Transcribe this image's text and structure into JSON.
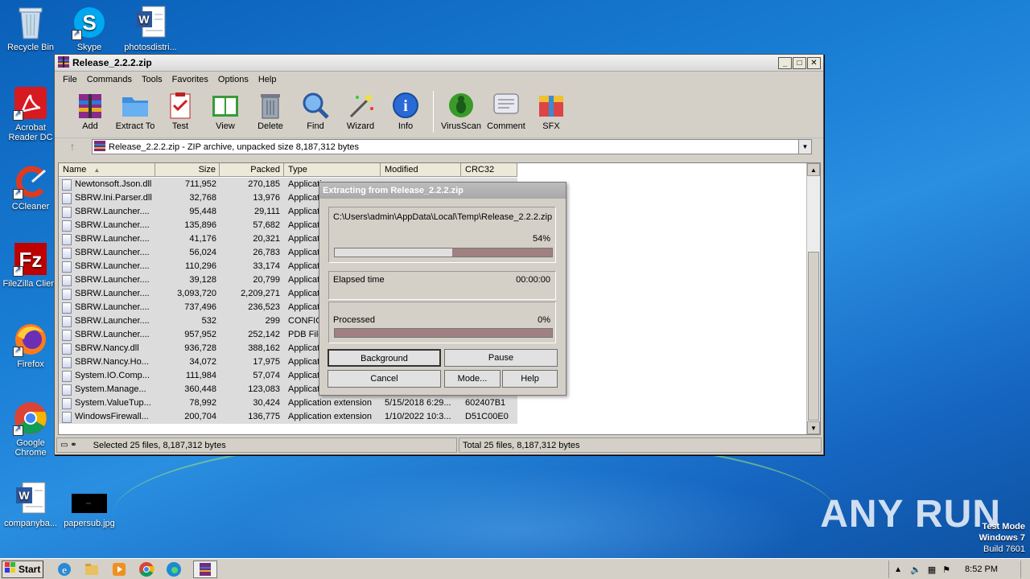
{
  "desktop": {
    "icons": [
      {
        "label": "Recycle Bin",
        "icon": "recycle-bin-icon"
      },
      {
        "label": "Skype",
        "icon": "skype-icon"
      },
      {
        "label": "photosdistri...",
        "icon": "word-document-icon"
      },
      {
        "label": "Acrobat Reader DC",
        "icon": "acrobat-icon"
      },
      {
        "label": "CCleaner",
        "icon": "ccleaner-icon"
      },
      {
        "label": "FileZilla Client",
        "icon": "filezilla-icon"
      },
      {
        "label": "Firefox",
        "icon": "firefox-icon"
      },
      {
        "label": "Google Chrome",
        "icon": "chrome-icon"
      },
      {
        "label": "companyba...",
        "icon": "word-document-icon"
      },
      {
        "label": "papersub.jpg",
        "icon": "image-file-icon"
      }
    ]
  },
  "window": {
    "title": "Release_2.2.2.zip",
    "menu": [
      "File",
      "Commands",
      "Tools",
      "Favorites",
      "Options",
      "Help"
    ],
    "toolbar": [
      {
        "label": "Add",
        "icon": "add-archive-icon"
      },
      {
        "label": "Extract To",
        "icon": "extract-folder-icon"
      },
      {
        "label": "Test",
        "icon": "test-clipboard-icon"
      },
      {
        "label": "View",
        "icon": "view-book-icon"
      },
      {
        "label": "Delete",
        "icon": "trash-icon"
      },
      {
        "label": "Find",
        "icon": "magnifier-icon"
      },
      {
        "label": "Wizard",
        "icon": "wand-icon"
      },
      {
        "label": "Info",
        "icon": "info-icon"
      },
      {
        "label": "VirusScan",
        "icon": "virus-scan-icon"
      },
      {
        "label": "Comment",
        "icon": "comment-icon"
      },
      {
        "label": "SFX",
        "icon": "sfx-icon"
      }
    ],
    "path": "Release_2.2.2.zip - ZIP archive, unpacked size 8,187,312 bytes",
    "columns": [
      "Name",
      "Size",
      "Packed",
      "Type",
      "Modified",
      "CRC32"
    ],
    "files": [
      {
        "name": "Newtonsoft.Json.dll",
        "size": "711,952",
        "packed": "270,185",
        "type": "Applicati",
        "modified": "",
        "crc": ""
      },
      {
        "name": "SBRW.Ini.Parser.dll",
        "size": "32,768",
        "packed": "13,976",
        "type": "Applicati",
        "modified": "",
        "crc": ""
      },
      {
        "name": "SBRW.Launcher....",
        "size": "95,448",
        "packed": "29,111",
        "type": "Applicati",
        "modified": "",
        "crc": ""
      },
      {
        "name": "SBRW.Launcher....",
        "size": "135,896",
        "packed": "57,682",
        "type": "Applicati",
        "modified": "",
        "crc": ""
      },
      {
        "name": "SBRW.Launcher....",
        "size": "41,176",
        "packed": "20,321",
        "type": "Applicati",
        "modified": "",
        "crc": ""
      },
      {
        "name": "SBRW.Launcher....",
        "size": "56,024",
        "packed": "26,783",
        "type": "Applicati",
        "modified": "",
        "crc": ""
      },
      {
        "name": "SBRW.Launcher....",
        "size": "110,296",
        "packed": "33,174",
        "type": "Applicati",
        "modified": "",
        "crc": ""
      },
      {
        "name": "SBRW.Launcher....",
        "size": "39,128",
        "packed": "20,799",
        "type": "Applicati",
        "modified": "",
        "crc": ""
      },
      {
        "name": "SBRW.Launcher....",
        "size": "3,093,720",
        "packed": "2,209,271",
        "type": "Applicati",
        "modified": "",
        "crc": ""
      },
      {
        "name": "SBRW.Launcher....",
        "size": "737,496",
        "packed": "236,523",
        "type": "Applicati",
        "modified": "",
        "crc": ""
      },
      {
        "name": "SBRW.Launcher....",
        "size": "532",
        "packed": "299",
        "type": "CONFIG",
        "modified": "",
        "crc": ""
      },
      {
        "name": "SBRW.Launcher....",
        "size": "957,952",
        "packed": "252,142",
        "type": "PDB File",
        "modified": "",
        "crc": ""
      },
      {
        "name": "SBRW.Nancy.dll",
        "size": "936,728",
        "packed": "388,162",
        "type": "Applicati",
        "modified": "",
        "crc": ""
      },
      {
        "name": "SBRW.Nancy.Ho...",
        "size": "34,072",
        "packed": "17,975",
        "type": "Applicati",
        "modified": "",
        "crc": ""
      },
      {
        "name": "System.IO.Comp...",
        "size": "111,984",
        "packed": "57,074",
        "type": "Applicati",
        "modified": "",
        "crc": ""
      },
      {
        "name": "System.Manage...",
        "size": "360,448",
        "packed": "123,083",
        "type": "Applicati",
        "modified": "",
        "crc": ""
      },
      {
        "name": "System.ValueTup...",
        "size": "78,992",
        "packed": "30,424",
        "type": "Application extension",
        "modified": "5/15/2018 6:29...",
        "crc": "602407B1"
      },
      {
        "name": "WindowsFirewall...",
        "size": "200,704",
        "packed": "136,775",
        "type": "Application extension",
        "modified": "1/10/2022 10:3...",
        "crc": "D51C00E0"
      }
    ],
    "status_left": "Selected 25 files, 8,187,312 bytes",
    "status_right": "Total 25 files, 8,187,312 bytes"
  },
  "dialog": {
    "title": "Extracting from Release_2.2.2.zip",
    "file_path": "C:\\Users\\admin\\AppData\\Local\\Temp\\Release_2.2.2.zip",
    "file_percent": "54%",
    "file_progress": 0.54,
    "elapsed_label": "Elapsed time",
    "elapsed_value": "00:00:00",
    "processed_label": "Processed",
    "processed_percent": "0%",
    "processed_progress": 0.0,
    "buttons": {
      "background": "Background",
      "pause": "Pause",
      "cancel": "Cancel",
      "mode": "Mode...",
      "help": "Help"
    }
  },
  "taskbar": {
    "start": "Start",
    "clock": "8:52 PM",
    "apps": [
      "ie-icon",
      "explorer-icon",
      "media-player-icon",
      "chrome-icon",
      "edge-icon",
      "winrar-icon"
    ]
  },
  "watermark": "ANY RUN",
  "test_mode": {
    "line1": "Test Mode",
    "line2": "Windows 7",
    "line3": "Build 7601"
  }
}
